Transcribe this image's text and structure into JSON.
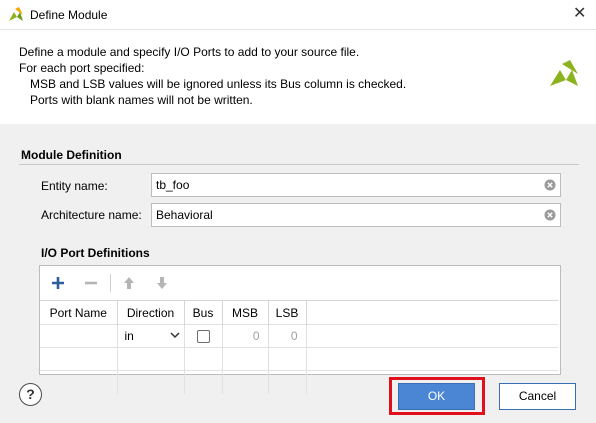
{
  "window": {
    "title": "Define Module",
    "close_glyph": "✕"
  },
  "header": {
    "lines": [
      "Define a module and specify I/O Ports to add to your source file.",
      "For each port specified:",
      "MSB and LSB values will be ignored unless its Bus column is checked.",
      "Ports with blank names will not be written."
    ]
  },
  "module_definition": {
    "title": "Module Definition",
    "entity_label": "Entity name:",
    "entity_value": "tb_foo",
    "architecture_label": "Architecture name:",
    "architecture_value": "Behavioral"
  },
  "io_ports": {
    "title": "I/O Port Definitions",
    "columns": [
      "Port Name",
      "Direction",
      "Bus",
      "MSB",
      "LSB"
    ],
    "rows": [
      {
        "port_name": "",
        "direction": "in",
        "bus": false,
        "msb": "0",
        "lsb": "0"
      }
    ]
  },
  "footer": {
    "help_label": "?",
    "ok_label": "OK",
    "cancel_label": "Cancel"
  },
  "colors": {
    "accent": "#4a86d4",
    "highlight": "#e0101d",
    "logo": "#8cb31e"
  },
  "icons": [
    "app-icon",
    "close-icon",
    "logo-icon",
    "clear-icon",
    "add-icon",
    "remove-icon",
    "move-up-icon",
    "move-down-icon",
    "chevron-down-icon",
    "help-icon"
  ]
}
